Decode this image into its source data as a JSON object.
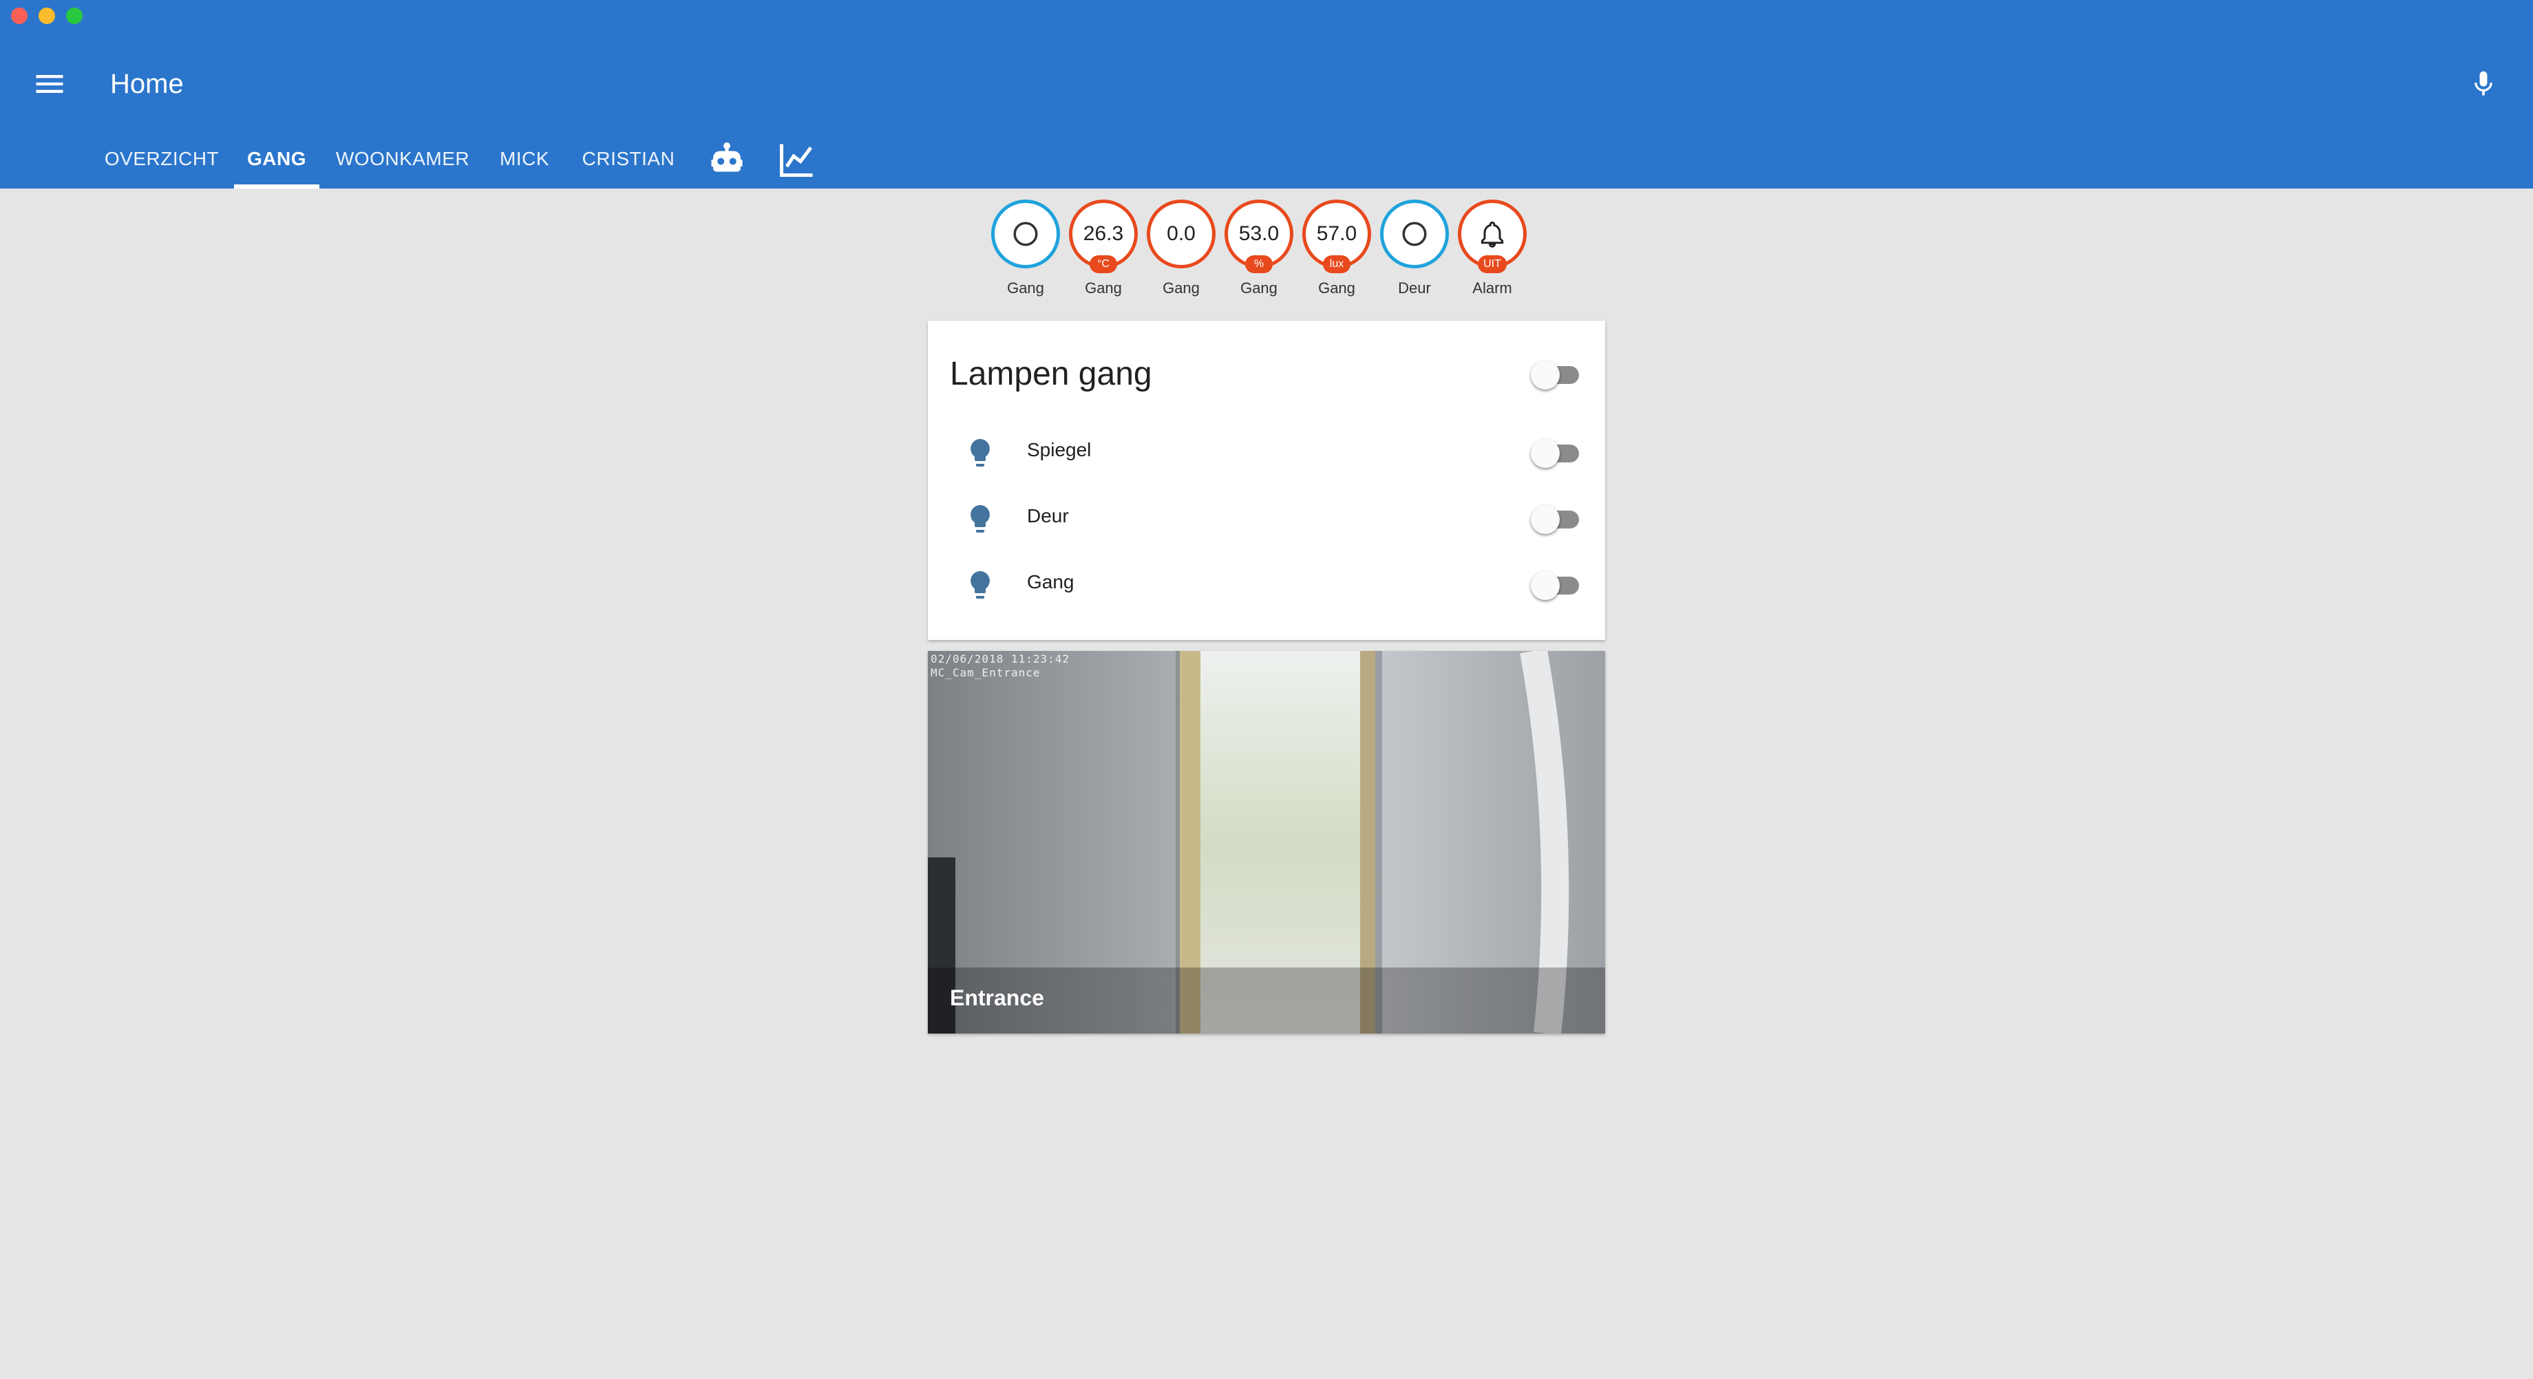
{
  "app": {
    "title": "Home"
  },
  "tabs": [
    {
      "label": "OVERZICHT"
    },
    {
      "label": "GANG",
      "active": true
    },
    {
      "label": "WOONKAMER"
    },
    {
      "label": "MICK"
    },
    {
      "label": "CRISTIAN"
    }
  ],
  "tab_icons": [
    "robot-icon",
    "chart-line-icon"
  ],
  "badges": [
    {
      "value": "",
      "unit": "",
      "label": "Gang",
      "icon": "circle-outline-icon",
      "color": "#1fa3dc"
    },
    {
      "value": "26.3",
      "unit": "°C",
      "label": "Gang",
      "color": "#e8491d"
    },
    {
      "value": "0.0",
      "unit": "",
      "label": "Gang",
      "color": "#e8491d"
    },
    {
      "value": "53.0",
      "unit": "%",
      "label": "Gang",
      "color": "#e8491d"
    },
    {
      "value": "57.0",
      "unit": "lux",
      "label": "Gang",
      "color": "#e8491d"
    },
    {
      "value": "",
      "unit": "",
      "label": "Deur",
      "icon": "circle-outline-icon",
      "color": "#1fa3dc"
    },
    {
      "value": "",
      "unit": "UIT",
      "label": "Alarm",
      "icon": "bell-icon",
      "color": "#e8491d"
    }
  ],
  "card": {
    "title": "Lampen gang",
    "entities": [
      {
        "name": "Spiegel",
        "icon": "lightbulb-icon",
        "on": false
      },
      {
        "name": "Deur",
        "icon": "lightbulb-icon",
        "on": false
      },
      {
        "name": "Gang",
        "icon": "lightbulb-icon",
        "on": false
      }
    ]
  },
  "camera": {
    "timestamp": "02/06/2018 11:23:42",
    "camera_id": "MC_Cam_Entrance",
    "caption": "Entrance"
  },
  "colors": {
    "header": "#2b76cc",
    "background": "#e5e5e5",
    "badge_orange": "#e8491d",
    "badge_blue": "#1fa3dc",
    "bulb": "#44739e"
  }
}
